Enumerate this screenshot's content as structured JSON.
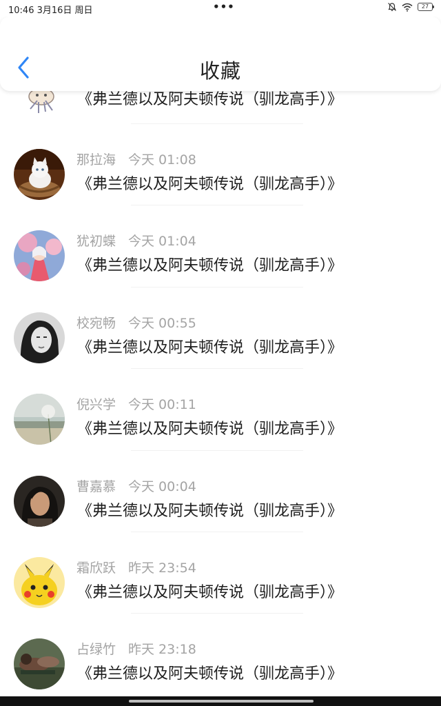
{
  "status_bar": {
    "time": "10:46",
    "date": "3月16日 周日",
    "dots": "•••",
    "battery": "27",
    "icons": [
      "bell-muted-icon",
      "wifi-icon",
      "battery-icon"
    ]
  },
  "header": {
    "title": "收藏",
    "back_icon": "chevron-left-icon",
    "accent_color": "#2f86f6"
  },
  "items": [
    {
      "name": "",
      "time": "",
      "title": "《弗兰德以及阿夫顿传说（驯龙高手）》",
      "avatar": "cartoon-illustration"
    },
    {
      "name": "那拉海",
      "time": "今天 01:08",
      "title": "《弗兰德以及阿夫顿传说（驯龙高手）》",
      "avatar": "kitten-photo"
    },
    {
      "name": "犹初蝶",
      "time": "今天 01:04",
      "title": "《弗兰德以及阿夫顿传说（驯龙高手）》",
      "avatar": "anime-girl-illustration"
    },
    {
      "name": "校宛畅",
      "time": "今天 00:55",
      "title": "《弗兰德以及阿夫顿传说（驯龙高手）》",
      "avatar": "bw-portrait-photo"
    },
    {
      "name": "倪兴学",
      "time": "今天 00:11",
      "title": "《弗兰德以及阿夫顿传说（驯龙高手）》",
      "avatar": "dandelion-photo"
    },
    {
      "name": "曹嘉慕",
      "time": "今天 00:04",
      "title": "《弗兰德以及阿夫顿传说（驯龙高手）》",
      "avatar": "woman-portrait-photo"
    },
    {
      "name": "霜欣跃",
      "time": "昨天 23:54",
      "title": "《弗兰德以及阿夫顿传说（驯龙高手）》",
      "avatar": "pikachu-illustration"
    },
    {
      "name": "占绿竹",
      "time": "昨天 23:18",
      "title": "《弗兰德以及阿夫顿传说（驯龙高手）》",
      "avatar": "couple-photo"
    }
  ]
}
